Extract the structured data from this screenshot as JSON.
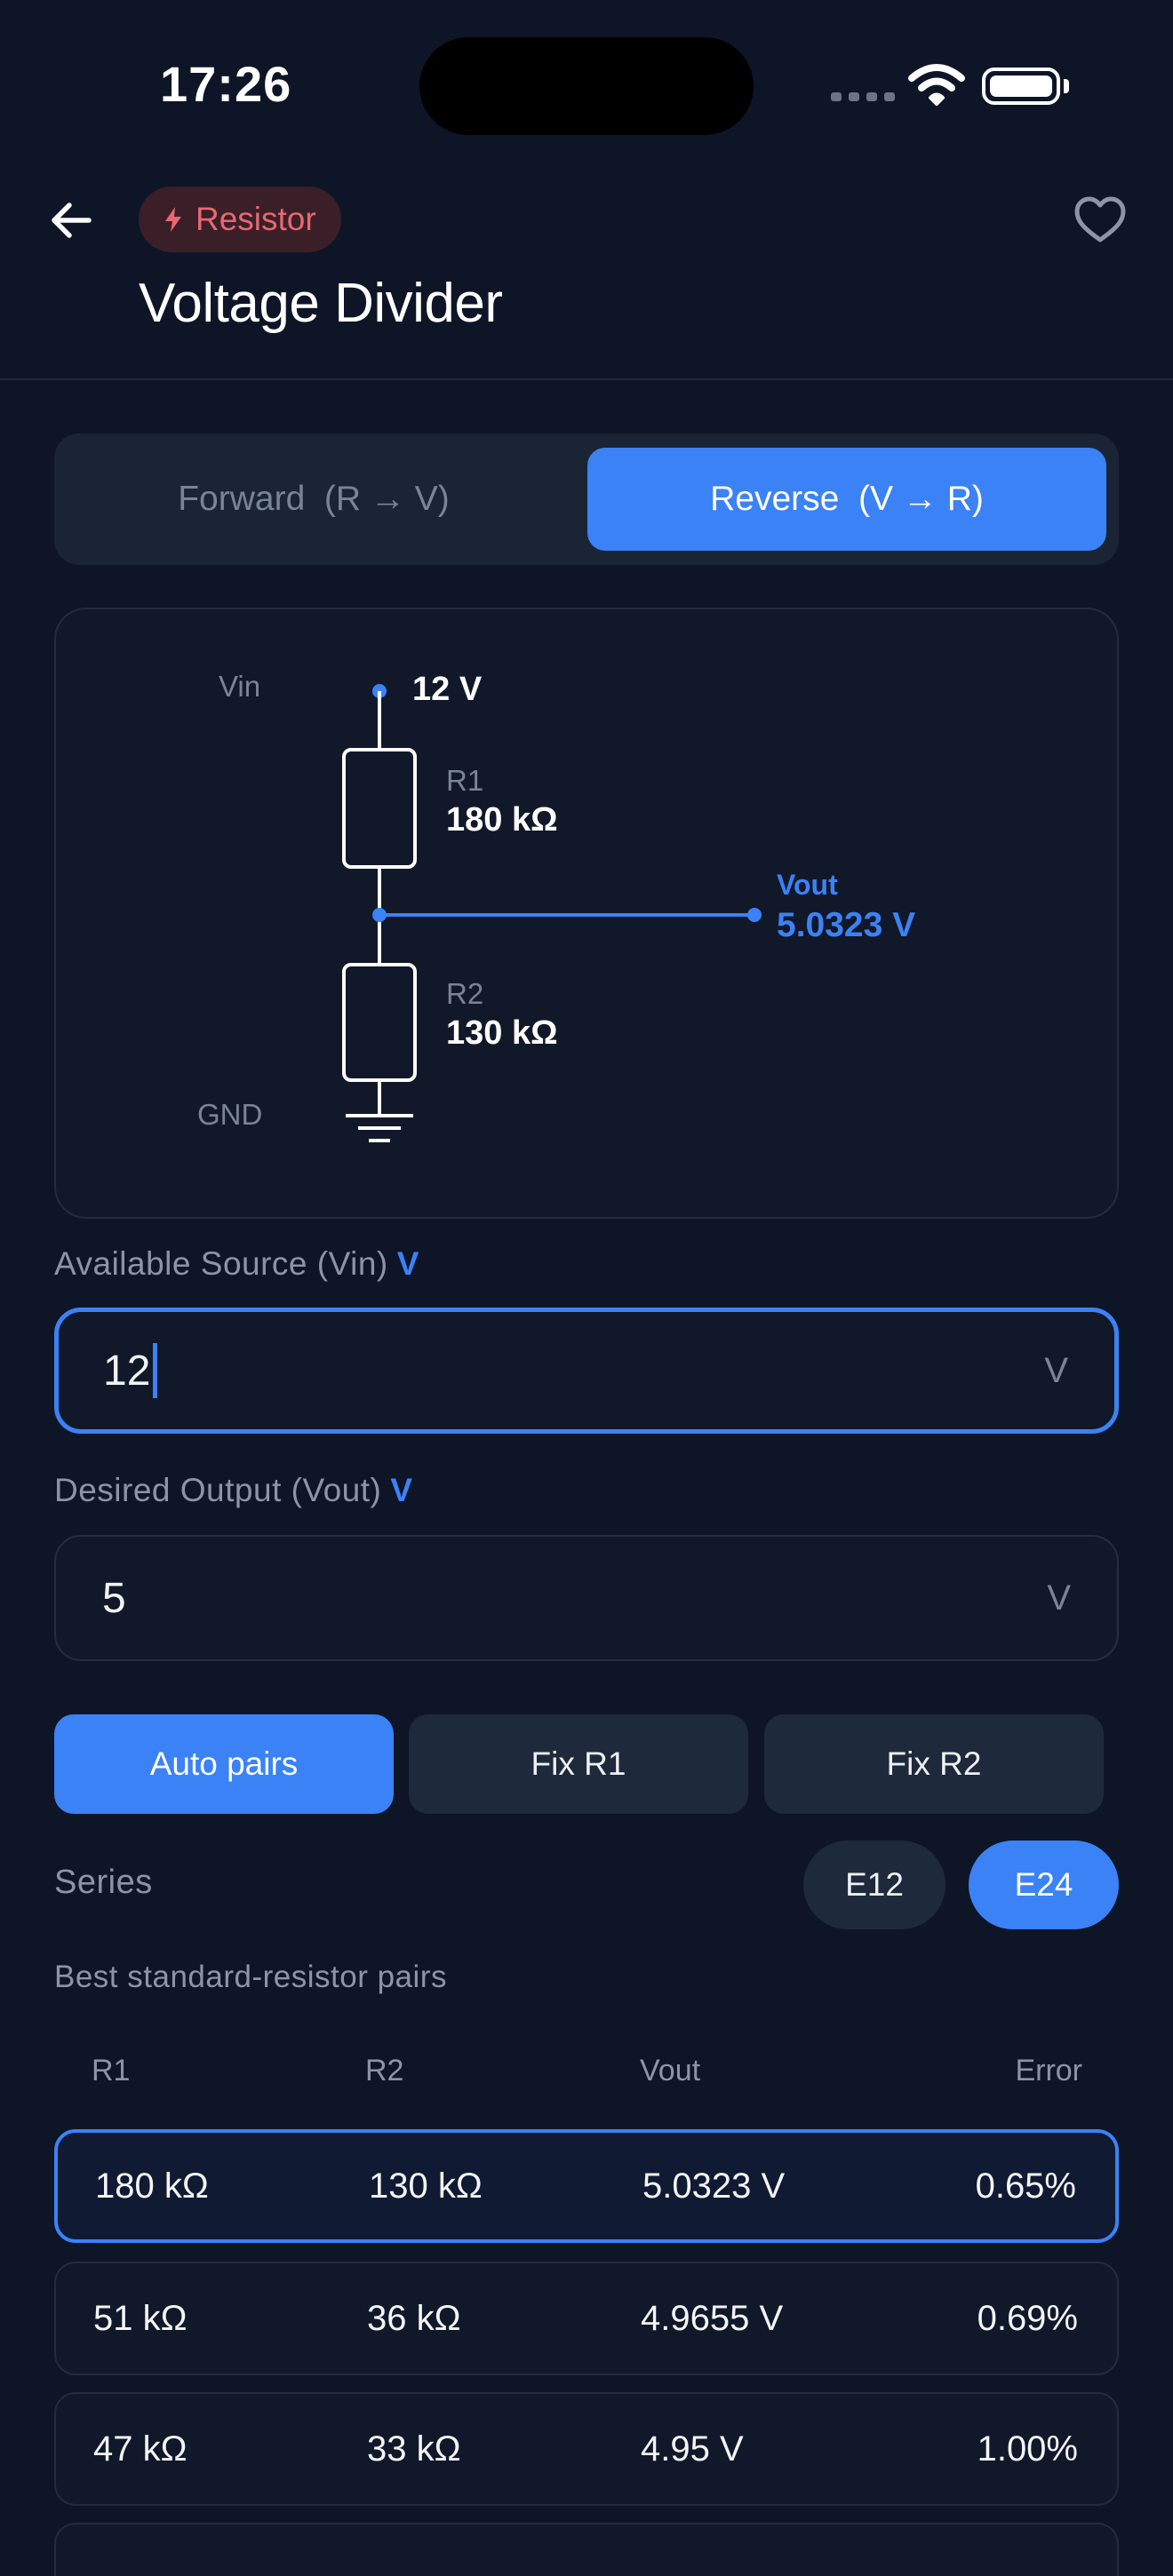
{
  "status_bar": {
    "time": "17:26"
  },
  "header": {
    "category": "Resistor",
    "title": "Voltage Divider"
  },
  "mode_toggle": {
    "forward_label": "Forward  (R → V)",
    "reverse_label": "Reverse  (V → R)",
    "selected": "reverse"
  },
  "diagram": {
    "vin_label": "Vin",
    "vin_value": "12 V",
    "r1_label": "R1",
    "r1_value": "180 kΩ",
    "r2_label": "R2",
    "r2_value": "130 kΩ",
    "vout_label": "Vout",
    "vout_value": "5.0323 V",
    "gnd_label": "GND"
  },
  "vin_field": {
    "label": "Available Source (Vin)",
    "unit_tag": "V",
    "value": "12",
    "suffix": "V"
  },
  "vout_field": {
    "label": "Desired Output (Vout)",
    "unit_tag": "V",
    "value": "5",
    "suffix": "V"
  },
  "solve_modes": {
    "auto_label": "Auto pairs",
    "fix_r1_label": "Fix R1",
    "fix_r2_label": "Fix R2",
    "selected": "auto"
  },
  "series": {
    "label": "Series",
    "options": [
      "E12",
      "E24"
    ],
    "selected": "E24"
  },
  "results": {
    "heading": "Best standard-resistor pairs",
    "columns": [
      "R1",
      "R2",
      "Vout",
      "Error"
    ],
    "rows": [
      {
        "r1": "180 kΩ",
        "r2": "130 kΩ",
        "vout": "5.0323 V",
        "error": "0.65%"
      },
      {
        "r1": "51 kΩ",
        "r2": "36 kΩ",
        "vout": "4.9655 V",
        "error": "0.69%"
      },
      {
        "r1": "47 kΩ",
        "r2": "33 kΩ",
        "vout": "4.95 V",
        "error": "1.00%"
      }
    ]
  },
  "colors": {
    "accent": "#3b82f6",
    "background": "#0e1527",
    "chip_text": "#e8686f"
  }
}
